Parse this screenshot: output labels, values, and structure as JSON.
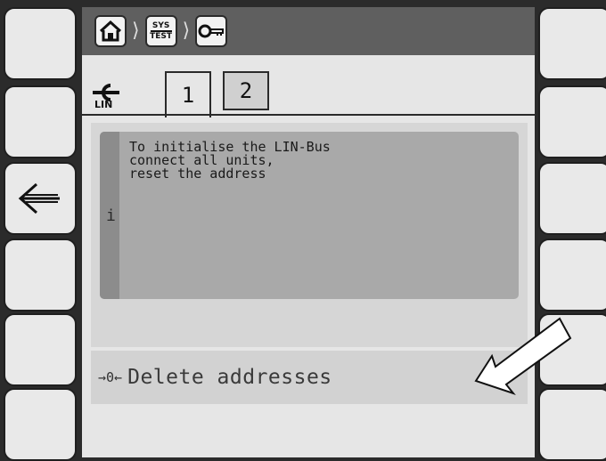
{
  "breadcrumb": {
    "items": [
      {
        "name": "home-icon"
      },
      {
        "label_top": "SYS",
        "label_bottom": "TEST"
      },
      {
        "name": "key-icon"
      }
    ]
  },
  "lin": {
    "label": "LIN"
  },
  "tabs": [
    {
      "label": "1",
      "active": true
    },
    {
      "label": "2",
      "active": false
    }
  ],
  "info": {
    "icon_text": "i",
    "message": "To initialise the LIN-Bus\nconnect all units,\nreset the address"
  },
  "action": {
    "symbol": "→0←",
    "label": "Delete addresses"
  },
  "softkeys": {
    "left_2": {
      "icon": "back-arrow-icon"
    }
  }
}
